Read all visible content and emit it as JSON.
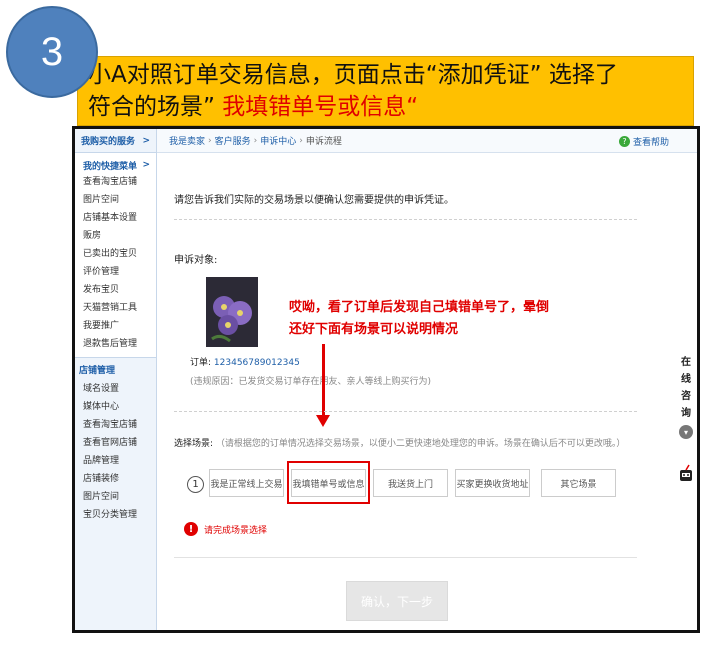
{
  "step": {
    "number": "3"
  },
  "banner": {
    "line1": "小A对照订单交易信息，页面点击“添加凭证” 选择了",
    "line2_black": "符合的场景” ",
    "line2_red": "我填错单号或信息“"
  },
  "sidebar": {
    "header": "我购买的服务",
    "quick_title": "我的快捷菜单",
    "quick_items": [
      "查看淘宝店铺",
      "图片空间",
      "店铺基本设置",
      "贩房",
      "已卖出的宝贝",
      "评价管理",
      "发布宝贝",
      "天猫营销工具",
      "我要推广",
      "退款售后管理"
    ],
    "store_title": "店铺管理",
    "store_items": [
      "域名设置",
      "媒体中心",
      "查看淘宝店铺",
      "查看官网店铺",
      "品牌管理",
      "店铺装修",
      "图片空间",
      "宝贝分类管理"
    ]
  },
  "breadcrumb": [
    "我是卖家",
    "客户服务",
    "申诉中心",
    "申诉流程"
  ],
  "help": {
    "label": "查看帮助",
    "icon": "question-icon"
  },
  "intro": "请您告诉我们实际的交易场景以便确认您需要提供的申诉凭证。",
  "appeal_target_label": "申诉对象:",
  "order": {
    "label": "订单:",
    "number": "123456789012345"
  },
  "reason": "(违规原因：已发货交易订单存在朋友、亲人等线上购买行为)",
  "annotation": {
    "line1": "哎呦，看了订单后发现自己填错单号了，晕倒",
    "line2": "还好下面有场景可以说明情况"
  },
  "scenario": {
    "label": "选择场景:",
    "hint": "（请根据您的订单情况选择交易场景，以便小二更快速地处理您的申诉。场景在确认后不可以更改哦。）",
    "number": "1",
    "options": [
      "我是正常线上交易",
      "我填错单号或信息",
      "我送货上门",
      "买家更换收货地址",
      "其它场景"
    ]
  },
  "error": "请完成场景选择",
  "confirm_button": "确认，下一步",
  "consult": {
    "chars": [
      "在",
      "线",
      "咨",
      "询"
    ]
  },
  "colors": {
    "banner_bg": "#ffc000",
    "step_circle": "#4f81bd",
    "accent_red": "#e00000",
    "link_blue": "#1f5fa8"
  }
}
